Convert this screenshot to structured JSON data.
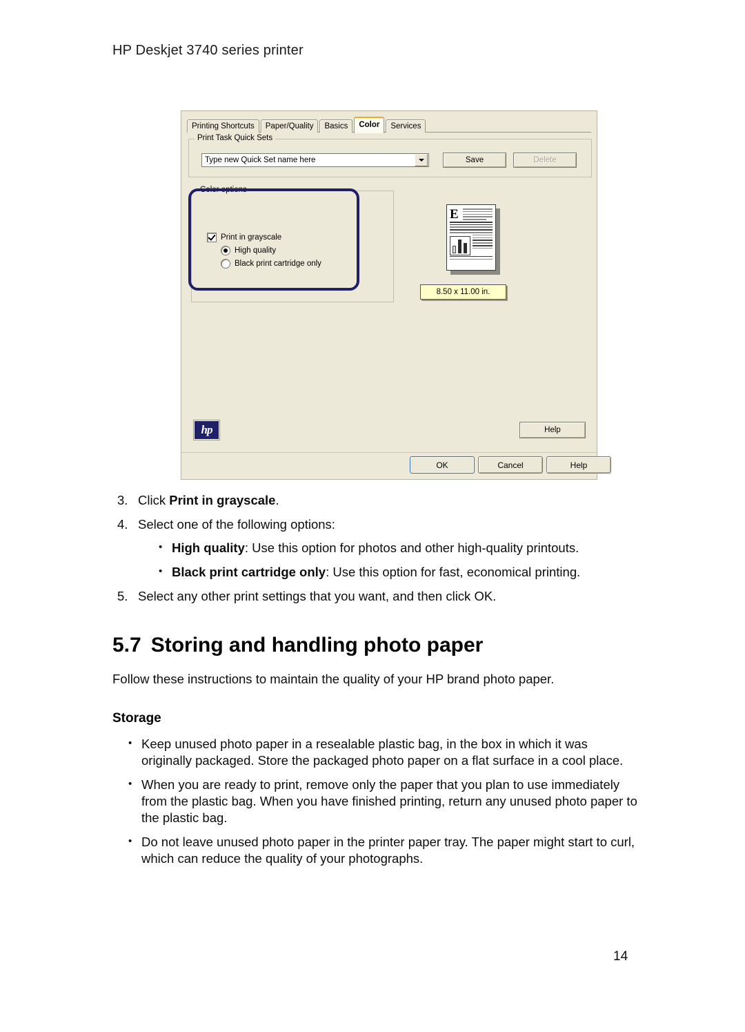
{
  "header": {
    "title": "HP Deskjet 3740 series printer"
  },
  "dialog": {
    "tabs": [
      {
        "label": "Printing Shortcuts",
        "active": false
      },
      {
        "label": "Paper/Quality",
        "active": false
      },
      {
        "label": "Basics",
        "active": false
      },
      {
        "label": "Color",
        "active": true
      },
      {
        "label": "Services",
        "active": false
      }
    ],
    "quick_sets": {
      "group_title": "Print Task Quick Sets",
      "combo_value": "Type new Quick Set name here",
      "save_label": "Save",
      "delete_label": "Delete"
    },
    "color_options": {
      "group_title": "Color options",
      "checkbox_label": "Print in grayscale",
      "checkbox_checked": "true",
      "radio_high_label": "High quality",
      "radio_black_label": "Black print cartridge only",
      "selected_radio": "High quality",
      "highlight_color": "#20206a"
    },
    "preview": {
      "dropcap": "E",
      "paper_size": "8.50 x 11.00 in."
    },
    "logo_text": "hp",
    "panel_help_label": "Help",
    "buttons": {
      "ok": "OK",
      "cancel": "Cancel",
      "help": "Help"
    }
  },
  "steps": {
    "step3_num": "3.",
    "step3_pre": "Click ",
    "step3_bold": "Print in grayscale",
    "step3_post": ".",
    "step4_num": "4.",
    "step4_text": "Select one of the following options:",
    "bullet_dot": "•",
    "opt1_bold": "High quality",
    "opt1_text": ": Use this option for photos and other high-quality printouts.",
    "opt2_bold": "Black print cartridge only",
    "opt2_text": ": Use this option for fast, economical printing.",
    "step5_num": "5.",
    "step5_text": "Select any other print settings that you want, and then click OK."
  },
  "section": {
    "number": "5.7",
    "title": "Storing and handling photo paper",
    "intro": "Follow these instructions to maintain the quality of your HP brand photo paper.",
    "sub_heading": "Storage",
    "bullets": [
      "Keep unused photo paper in a resealable plastic bag, in the box in which it was originally packaged. Store the packaged photo paper on a flat surface in a cool place.",
      "When you are ready to print, remove only the paper that you plan to use immediately from the plastic bag. When you have finished printing, return any unused photo paper to the plastic bag.",
      "Do not leave unused photo paper in the printer paper tray. The paper might start to curl, which can reduce the quality of your photographs."
    ]
  },
  "footer": {
    "page_number": "14"
  }
}
